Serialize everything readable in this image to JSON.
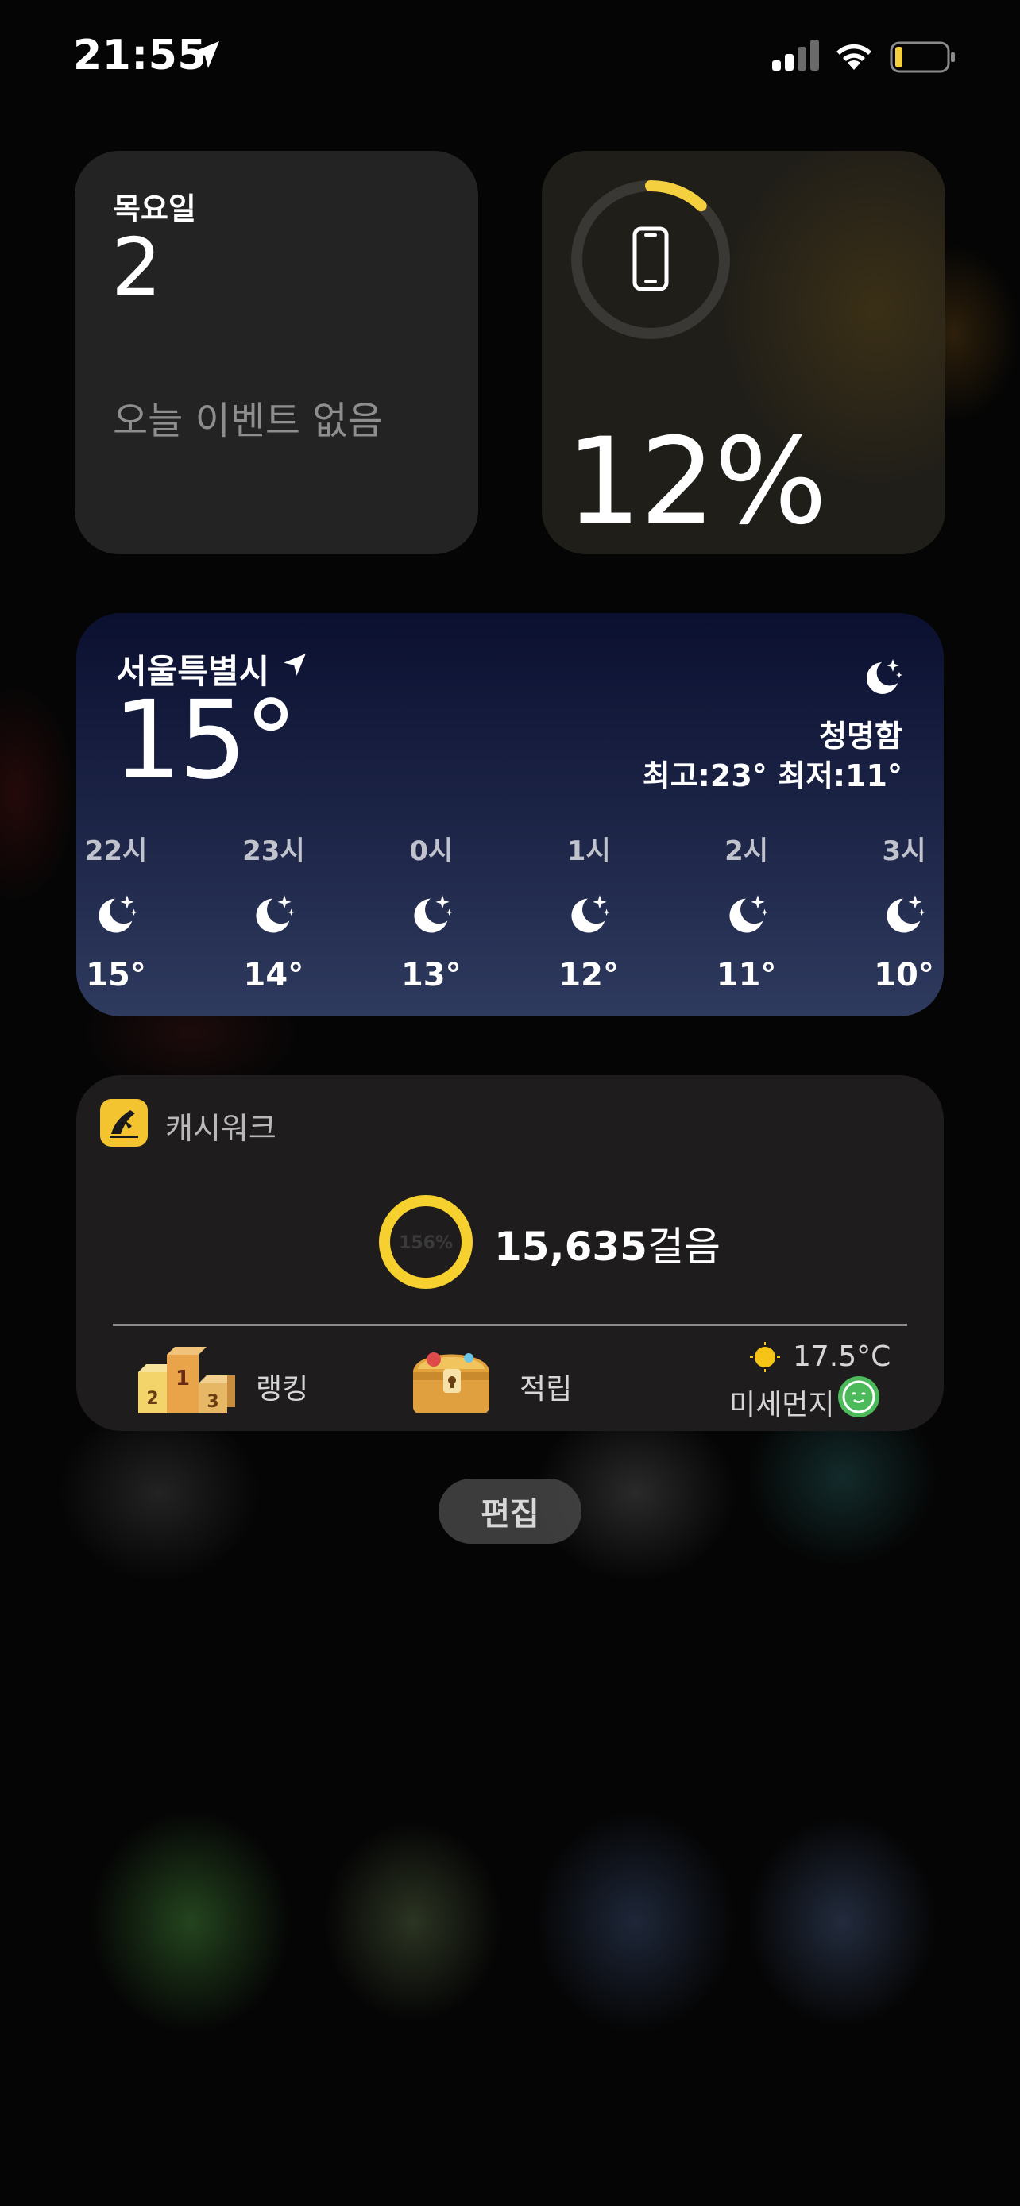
{
  "status_bar": {
    "time": "21:55",
    "battery_level": 0.12,
    "battery_color": "#f4d03f"
  },
  "calendar_widget": {
    "weekday": "목요일",
    "day": "2",
    "events_text": "오늘 이벤트 없음"
  },
  "battery_widget": {
    "device_icon": "iphone-icon",
    "percent_text": "12%",
    "level": 0.12,
    "ring_color": "#f4d03f"
  },
  "weather_widget": {
    "city": "서울특별시",
    "temperature": "15°",
    "condition_icon": "moon-stars-icon",
    "condition": "청명함",
    "high_low": "최고:23° 최저:11°",
    "hourly": [
      {
        "hour": "22시",
        "icon": "moon-stars-icon",
        "temp": "15°"
      },
      {
        "hour": "23시",
        "icon": "moon-stars-icon",
        "temp": "14°"
      },
      {
        "hour": "0시",
        "icon": "moon-stars-icon",
        "temp": "13°"
      },
      {
        "hour": "1시",
        "icon": "moon-stars-icon",
        "temp": "12°"
      },
      {
        "hour": "2시",
        "icon": "moon-stars-icon",
        "temp": "11°"
      },
      {
        "hour": "3시",
        "icon": "moon-stars-icon",
        "temp": "10°"
      }
    ]
  },
  "cashwalk_widget": {
    "app_name": "캐시워크",
    "ring_text": "156%",
    "ring_color": "#f6d02e",
    "steps": "15,635",
    "steps_unit": "걸음",
    "ranking_label": "랭킹",
    "save_label": "적립",
    "weather_temp": "17.5°C",
    "dust_label": "미세먼지"
  },
  "edit_button": {
    "label": "편집"
  }
}
